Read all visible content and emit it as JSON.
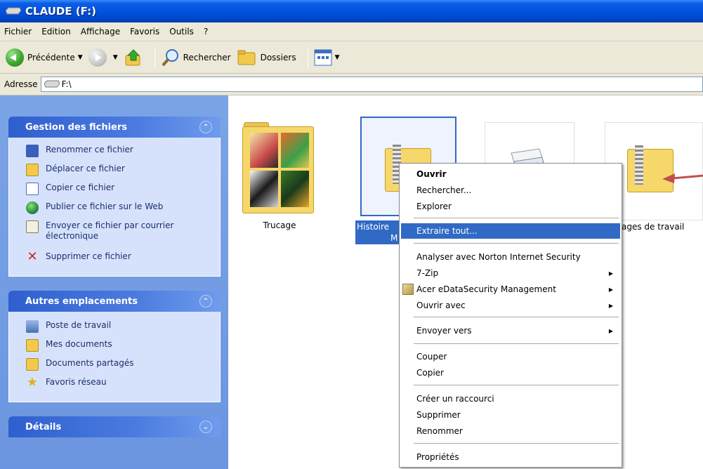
{
  "window": {
    "title": "CLAUDE (F:)"
  },
  "menu": [
    "Fichier",
    "Edition",
    "Affichage",
    "Favoris",
    "Outils",
    "?"
  ],
  "toolbar": {
    "back": "Précédente",
    "search": "Rechercher",
    "folders": "Dossiers"
  },
  "address": {
    "label": "Adresse",
    "value": "F:\\"
  },
  "tasks": {
    "file_panel": {
      "title": "Gestion des fichiers",
      "items": [
        {
          "label": "Renommer ce fichier",
          "icon": "rename-icon"
        },
        {
          "label": "Déplacer ce fichier",
          "icon": "move-icon"
        },
        {
          "label": "Copier ce fichier",
          "icon": "copy-icon"
        },
        {
          "label": "Publier ce fichier sur le Web",
          "icon": "globe-icon"
        },
        {
          "label": "Envoyer ce fichier par courrier électronique",
          "icon": "mail-icon"
        },
        {
          "label": "Supprimer ce fichier",
          "icon": "delete-icon"
        }
      ]
    },
    "places_panel": {
      "title": "Autres emplacements",
      "items": [
        {
          "label": "Poste de travail",
          "icon": "computer-icon"
        },
        {
          "label": "Mes documents",
          "icon": "documents-icon"
        },
        {
          "label": "Documents partagés",
          "icon": "shared-folder-icon"
        },
        {
          "label": "Favoris réseau",
          "icon": "network-icon"
        }
      ]
    },
    "details_panel": {
      "title": "Détails"
    }
  },
  "files": [
    {
      "name": "Trucage",
      "type": "folder"
    },
    {
      "name": "Histoire",
      "type": "zip",
      "selected": true,
      "caption_line2": "M"
    },
    {
      "name": "",
      "type": "file"
    },
    {
      "name": "ages de travail",
      "type": "zip"
    }
  ],
  "context_menu": {
    "items": [
      {
        "label": "Ouvrir",
        "bold": true
      },
      {
        "label": "Rechercher..."
      },
      {
        "label": "Explorer"
      },
      {
        "label": "Extraire tout...",
        "highlighted": true
      },
      {
        "label": "Analyser avec Norton Internet Security"
      },
      {
        "label": "7-Zip",
        "submenu": true
      },
      {
        "label": "Acer eDataSecurity Management",
        "submenu": true
      },
      {
        "label": "Ouvrir avec",
        "submenu": true
      },
      {
        "label": "Envoyer vers",
        "submenu": true
      },
      {
        "label": "Couper"
      },
      {
        "label": "Copier"
      },
      {
        "label": "Créer un raccourci"
      },
      {
        "label": "Supprimer"
      },
      {
        "label": "Renommer"
      },
      {
        "label": "Propriétés"
      }
    ]
  },
  "colors": {
    "accent": "#316ac5",
    "titlebar": "#0050dc",
    "pane": "#6b95e0",
    "annotation_arrow": "#c0504d"
  }
}
